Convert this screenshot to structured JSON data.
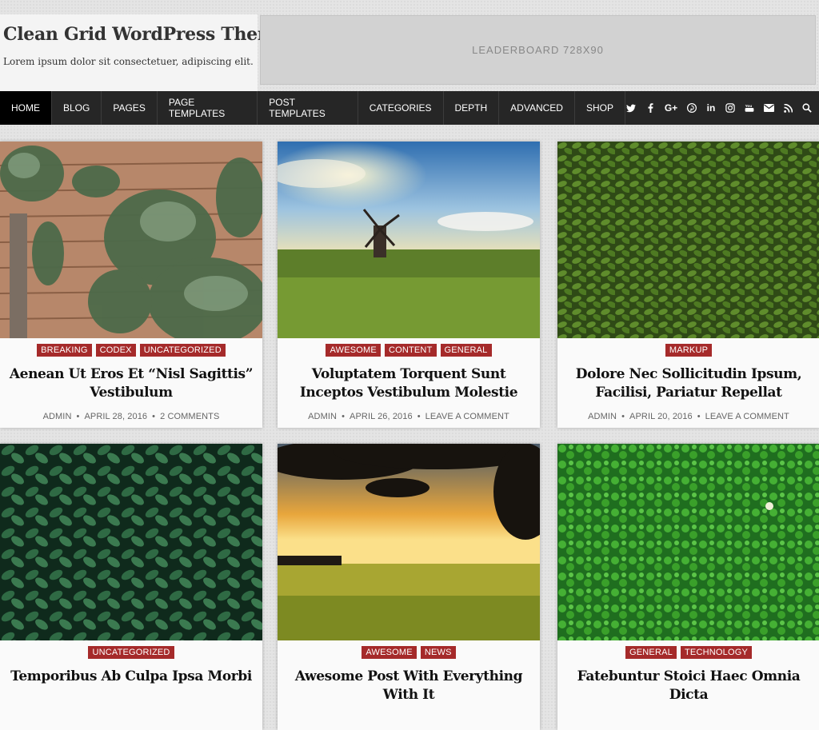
{
  "site": {
    "title": "Clean Grid WordPress Theme",
    "description": "Lorem ipsum dolor sit consectetuer, adipiscing elit.",
    "leaderboard": "LEADERBOARD 728X90"
  },
  "nav": {
    "items": [
      "HOME",
      "BLOG",
      "PAGES",
      "PAGE TEMPLATES",
      "POST TEMPLATES",
      "CATEGORIES",
      "DEPTH",
      "ADVANCED",
      "SHOP"
    ],
    "active_index": 0,
    "icons": [
      "twitter-icon",
      "facebook-icon",
      "google-plus-icon",
      "pinterest-icon",
      "linkedin-icon",
      "instagram-icon",
      "youtube-icon",
      "email-icon",
      "rss-icon",
      "search-icon"
    ]
  },
  "colors": {
    "nav_bg": "#262626",
    "badge_bg": "#a52a2a"
  },
  "posts": [
    {
      "categories": [
        "BREAKING",
        "CODEX",
        "UNCATEGORIZED"
      ],
      "title": "Aenean Ut Eros Et “Nisl Sagittis” Vestibulum",
      "author": "ADMIN",
      "date": "APRIL 28, 2016",
      "comments": "2 COMMENTS",
      "image": "ivy-on-wooden-fence"
    },
    {
      "categories": [
        "AWESOME",
        "CONTENT",
        "GENERAL"
      ],
      "title": "Voluptatem Torquent Sunt Inceptos Vestibulum Molestie",
      "author": "ADMIN",
      "date": "APRIL 26, 2016",
      "comments": "LEAVE A COMMENT",
      "image": "windmill-in-field"
    },
    {
      "categories": [
        "MARKUP"
      ],
      "title": "Dolore Nec Sollicitudin Ipsum, Facilisi, Pariatur Repellat",
      "author": "ADMIN",
      "date": "APRIL 20, 2016",
      "comments": "LEAVE A COMMENT",
      "image": "green-leaves"
    },
    {
      "categories": [
        "UNCATEGORIZED"
      ],
      "title": "Temporibus Ab Culpa Ipsa Morbi",
      "image": "dark-green-leaves"
    },
    {
      "categories": [
        "AWESOME",
        "NEWS"
      ],
      "title": "Awesome Post With Everything With It",
      "image": "sunset-field-tree"
    },
    {
      "categories": [
        "GENERAL",
        "TECHNOLOGY"
      ],
      "title": "Fatebuntur Stoici Haec Omnia Dicta",
      "image": "clover-leaves"
    }
  ]
}
